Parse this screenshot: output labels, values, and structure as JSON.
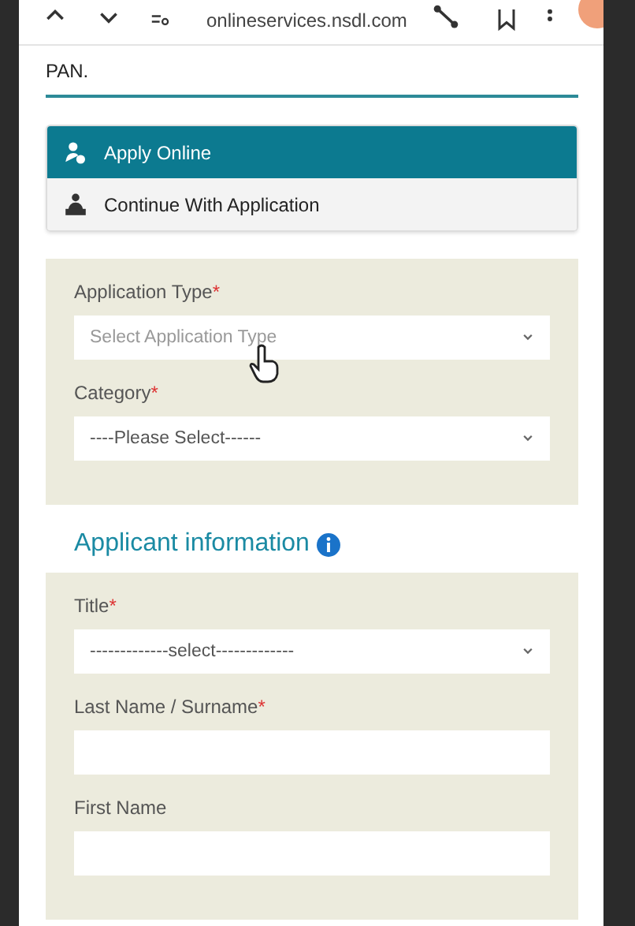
{
  "browser_bar": {
    "url": "onlineservices.nsdl.com"
  },
  "page_heading": "PAN.",
  "menu": [
    {
      "label": "Apply Online",
      "selected": true
    },
    {
      "label": "Continue With Application",
      "selected": false
    }
  ],
  "sections": [
    {
      "fields": [
        {
          "kind": "select",
          "label": "Application Type",
          "required": "*",
          "placeholder": "Select Application Type"
        },
        {
          "kind": "select",
          "label": "Category",
          "required": "*",
          "value": "----Please Select------"
        }
      ]
    },
    {
      "heading": "Applicant information",
      "fields": [
        {
          "kind": "select",
          "label": "Title",
          "required": "*",
          "value": "-------------select-------------"
        },
        {
          "kind": "text",
          "label": "Last Name / Surname",
          "required": "*"
        },
        {
          "kind": "text",
          "label": "First Name"
        }
      ]
    }
  ]
}
